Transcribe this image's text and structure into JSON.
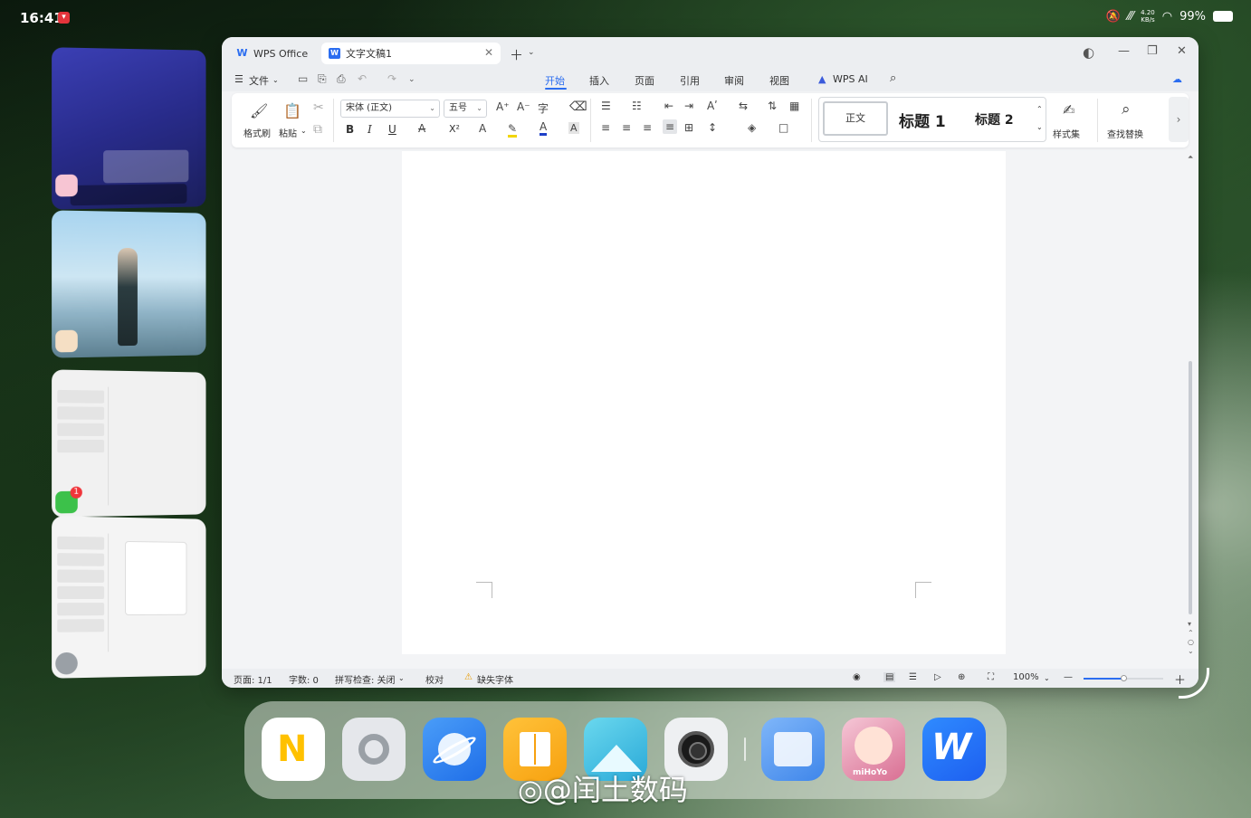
{
  "status_bar": {
    "time": "16:41",
    "net_speed_value": "4.20",
    "net_speed_unit": "KB/s",
    "battery": "99%"
  },
  "window": {
    "tabs": [
      {
        "label": "WPS Office",
        "icon": "wps-logo-icon"
      },
      {
        "label": "文字文稿1",
        "icon": "word-doc-icon"
      }
    ],
    "menu": {
      "file": "文件",
      "items": [
        "开始",
        "插入",
        "页面",
        "引用",
        "审阅",
        "视图"
      ],
      "active": "开始",
      "ai": "WPS AI"
    },
    "ribbon": {
      "format_painter": "格式刷",
      "paste": "粘贴",
      "font_name": "宋体 (正文)",
      "font_size": "五号",
      "bold": "B",
      "italic": "I",
      "underline": "U",
      "superscript": "X²",
      "styles": {
        "normal": "正文",
        "h1": "标题 1",
        "h2": "标题 2"
      },
      "style_set": "样式集",
      "find_replace": "查找替换"
    },
    "statusbar": {
      "page": "页面: 1/1",
      "word_count": "字数: 0",
      "spell_check": "拼写检查: 关闭",
      "proofread": "校对",
      "missing_font": "缺失字体",
      "zoom": "100%"
    }
  },
  "watermark": "@闰土数码",
  "wechat_badge": "1",
  "dock": {
    "apps": [
      "notes",
      "settings",
      "browser",
      "books",
      "gallery",
      "camera",
      "files",
      "game",
      "wps"
    ],
    "game_label": "miHoYo"
  }
}
